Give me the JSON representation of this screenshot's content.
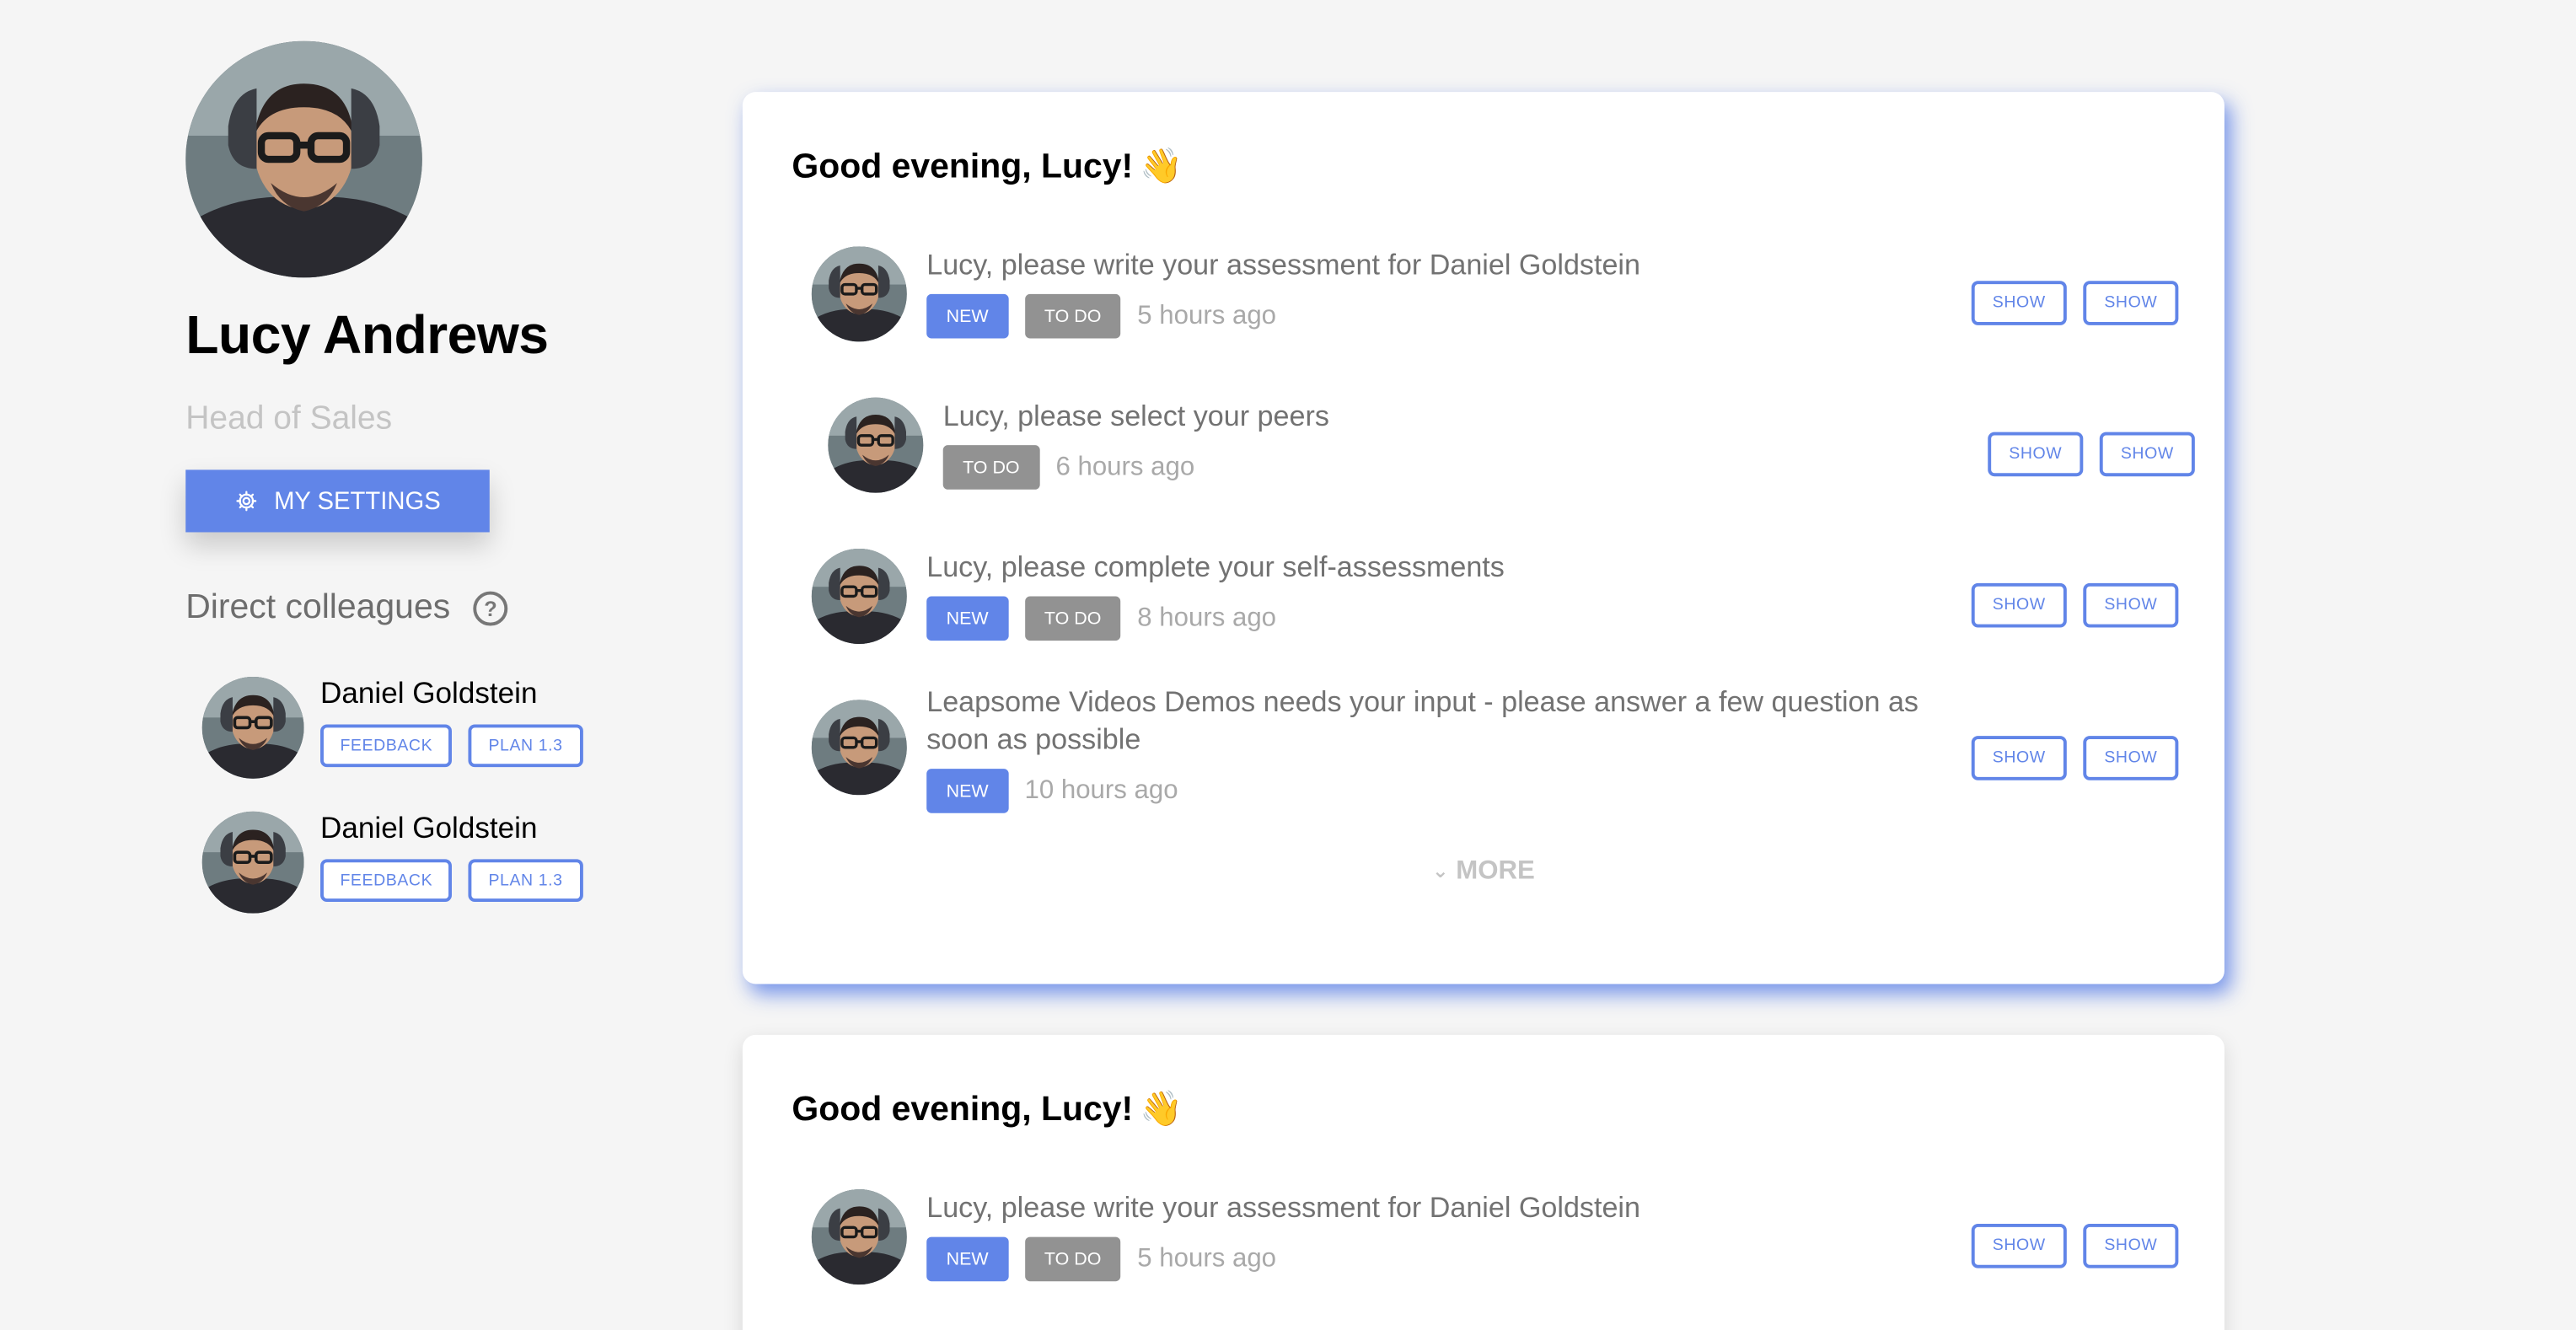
{
  "profile": {
    "name": "Lucy Andrews",
    "role": "Head of Sales",
    "settings_label": "MY SETTINGS"
  },
  "colleagues": {
    "heading": "Direct colleagues",
    "help_glyph": "?",
    "items": [
      {
        "name": "Daniel Goldstein",
        "tags": [
          "FEEDBACK",
          "PLAN 1.3"
        ]
      },
      {
        "name": "Daniel Goldstein",
        "tags": [
          "FEEDBACK",
          "PLAN 1.3"
        ]
      }
    ]
  },
  "cards": [
    {
      "greeting": "Good evening, Lucy!",
      "emoji": "👋",
      "tasks": [
        {
          "title": "Lucy, please write your assessment for Daniel Goldstein",
          "badges": [
            "NEW",
            "TO DO"
          ],
          "time": "5 hours ago",
          "actions": [
            "SHOW",
            "SHOW"
          ]
        },
        {
          "title": "Lucy, please select your peers",
          "badges": [
            "TO DO"
          ],
          "time": "6 hours ago",
          "actions": [
            "SHOW",
            "SHOW"
          ]
        },
        {
          "title": "Lucy, please complete your self-assessments",
          "badges": [
            "NEW",
            "TO DO"
          ],
          "time": "8 hours ago",
          "actions": [
            "SHOW",
            "SHOW"
          ]
        },
        {
          "title_line1": "Leapsome Videos Demos needs your input - please answer a few question as",
          "title_line2": "soon as possible",
          "badges": [
            "NEW"
          ],
          "time": "10 hours ago",
          "actions": [
            "SHOW",
            "SHOW"
          ]
        }
      ],
      "more_label": "MORE"
    },
    {
      "greeting": "Good evening, Lucy!",
      "emoji": "👋",
      "tasks": [
        {
          "title": "Lucy, please write your assessment for Daniel Goldstein",
          "badges": [
            "NEW",
            "TO DO"
          ],
          "time": "5 hours ago",
          "actions": [
            "SHOW",
            "SHOW"
          ]
        }
      ]
    }
  ],
  "icons": {
    "settings": "gear-icon",
    "help": "question-circle-icon",
    "more": "chevron-down-icon",
    "emoji": "waving-hand"
  },
  "colors": {
    "accent": "#6185e8",
    "todo_badge": "#929292",
    "background": "#f5f5f5"
  }
}
